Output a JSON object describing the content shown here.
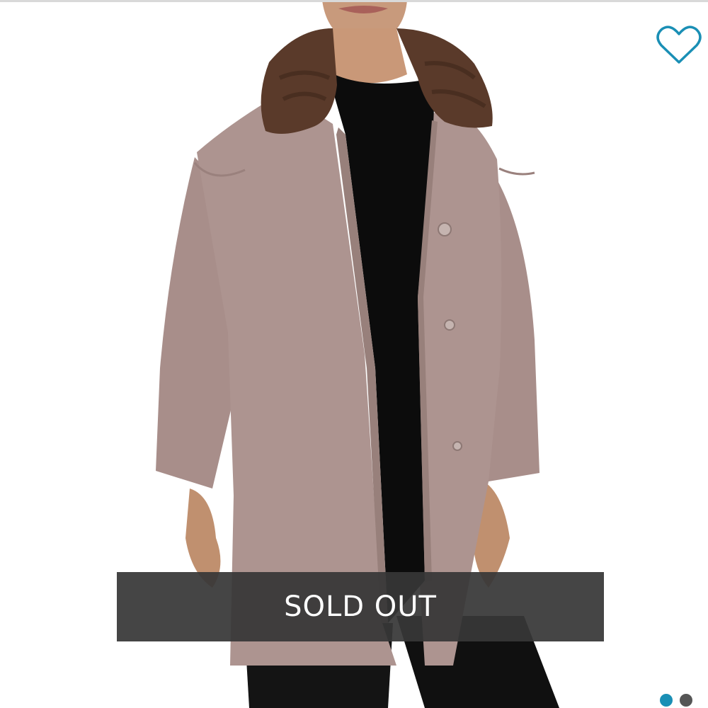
{
  "listing": {
    "sold_label": "SOLD OUT",
    "favorite_icon": "heart-outline-icon",
    "colors": {
      "accent": "#1a8fb5",
      "banner_bg": "#373737",
      "banner_text": "#ffffff",
      "coat": "#ad9490",
      "collar": "#5a3a2a",
      "top": "#0c0c0c"
    }
  },
  "carousel": {
    "total_images": 2,
    "active_index": 0,
    "dots": [
      {
        "name": "carousel-dot-1",
        "color": "#1a8fb5"
      },
      {
        "name": "carousel-dot-2",
        "color": "#555555"
      }
    ]
  }
}
